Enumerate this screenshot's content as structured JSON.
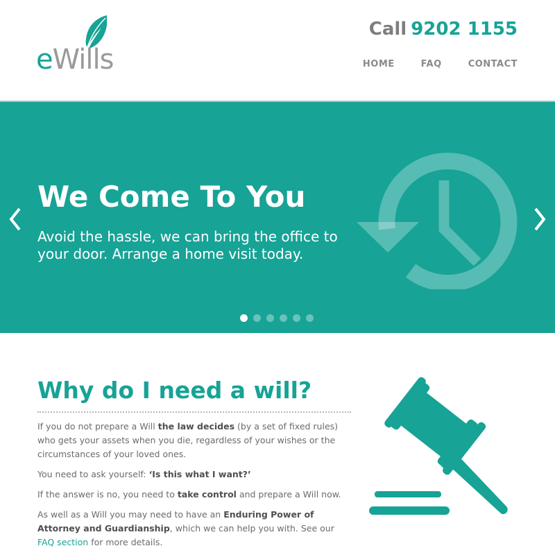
{
  "brand": {
    "logo_e": "e",
    "logo_rest": "Wills",
    "accent": "#17a396",
    "grey": "#8a8a8a"
  },
  "header": {
    "phone_label": "Call",
    "phone_number": "9202 1155",
    "nav": [
      "HOME",
      "FAQ",
      "CONTACT"
    ]
  },
  "hero": {
    "title": "We Come To You",
    "subtitle": "Avoid the hassle, we can bring the office to your door. Arrange a home visit today.",
    "icon": "clock-history-icon",
    "slides_total": 6,
    "active_slide": 1
  },
  "content": {
    "title": "Why do I need a will?",
    "p1_pre": "If you do not prepare a Will ",
    "p1_bold": "the law decides",
    "p1_post": " (by a set of fixed rules) who gets your assets when you die, regardless of your wishes or the circumstances of your loved ones.",
    "p2_pre": "You need to ask yourself: ",
    "p2_bold": "‘Is this what I want?’",
    "p3_pre": "If the answer is no, you need to ",
    "p3_bold": "take control",
    "p3_post": " and prepare a Will now.",
    "p4_pre": "As well as a Will you may need to have an ",
    "p4_bold": "Enduring Power of Attorney and Guardianship",
    "p4_mid": ", which we can help you with. See our ",
    "p4_link": "FAQ section",
    "p4_post": " for more details.",
    "icon": "gavel-icon"
  }
}
